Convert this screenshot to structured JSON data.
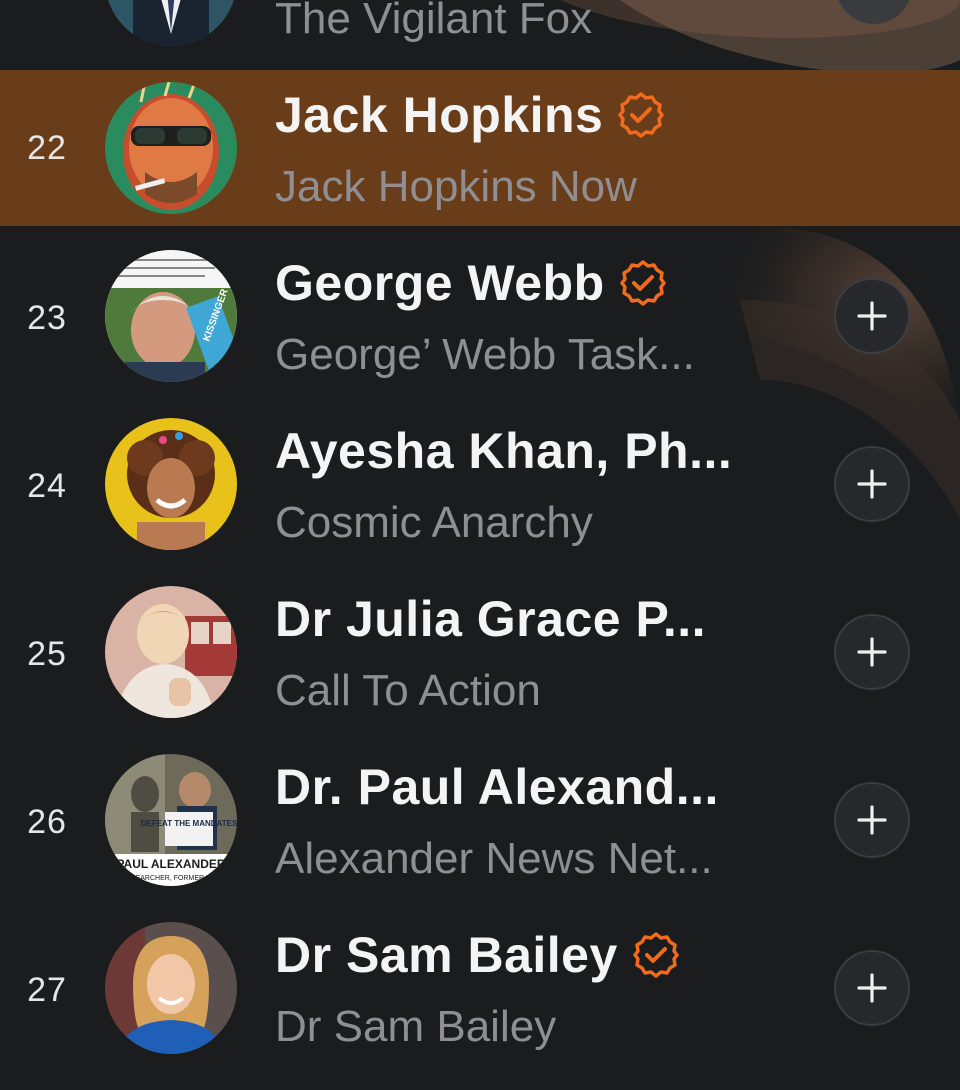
{
  "colors": {
    "background": "#1b1c1e",
    "highlight_row": "#6a3d1a",
    "verified_badge": "#f26a1b",
    "name_text": "#f4f4f4",
    "subtitle_text": "#8f8f93"
  },
  "partial_row": {
    "subtitle": "The Vigilant Fox"
  },
  "rows": [
    {
      "rank": "22",
      "name": "Jack Hopkins",
      "subtitle": "Jack Hopkins Now",
      "verified": true,
      "highlighted": true,
      "action_icon": "plus-icon"
    },
    {
      "rank": "23",
      "name": "George Webb",
      "subtitle": "George’ Webb Task...",
      "verified": true,
      "highlighted": false,
      "action_icon": "plus-icon"
    },
    {
      "rank": "24",
      "name": "Ayesha Khan, Ph...",
      "subtitle": "Cosmic Anarchy",
      "verified": false,
      "highlighted": false,
      "action_icon": "plus-icon"
    },
    {
      "rank": "25",
      "name": "Dr Julia Grace P...",
      "subtitle": "Call To Action",
      "verified": false,
      "highlighted": false,
      "action_icon": "plus-icon"
    },
    {
      "rank": "26",
      "name": "Dr. Paul Alexand...",
      "subtitle": "Alexander News Net...",
      "verified": false,
      "highlighted": false,
      "action_icon": "plus-icon"
    },
    {
      "rank": "27",
      "name": "Dr Sam Bailey",
      "subtitle": "Dr Sam Bailey",
      "verified": true,
      "highlighted": false,
      "action_icon": "plus-icon"
    }
  ],
  "avatar_texts": {
    "george_sign": "KISSINGER",
    "paul_sign": "DEFEAT THE MANDATES",
    "paul_caption": "PAUL ALEXANDER",
    "paul_caption_sub": "RESEARCHER, FORMER HHS"
  }
}
